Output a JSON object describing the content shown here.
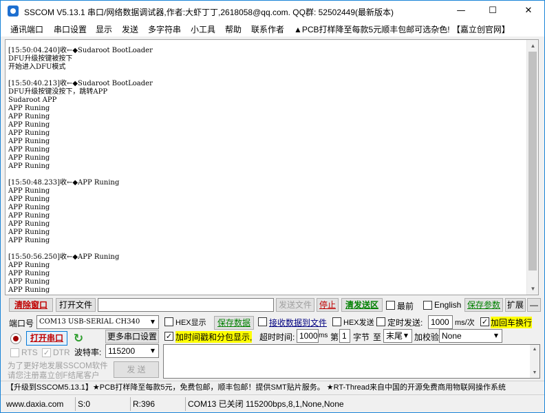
{
  "window": {
    "title": "SSCOM V5.13.1 串口/网络数据调试器,作者:大虾丁丁,2618058@qq.com. QQ群: 52502449(最新版本)",
    "minimize": "—",
    "maximize": "☐",
    "close": "✕"
  },
  "menu": {
    "items": [
      "通讯端口",
      "串口设置",
      "显示",
      "发送",
      "多字符串",
      "小工具",
      "帮助",
      "联系作者",
      "▲PCB打样降至每款5元顺丰包邮可选杂色! 【嘉立创官网】"
    ]
  },
  "receive": {
    "lines": [
      "[15:50:04.240]收←◆Sudaroot BootLoader",
      "DFU升级按键被按下",
      "开始进入DFU模式",
      "",
      "[15:50:40.213]收←◆Sudaroot BootLoader",
      "DFU升级按键没按下，跳转APP",
      "Sudaroot APP",
      "APP Runing",
      "APP Runing",
      "APP Runing",
      "APP Runing",
      "APP Runing",
      "APP Runing",
      "APP Runing",
      "APP Runing",
      "",
      "[15:50:48.233]收←◆APP Runing",
      "APP Runing",
      "APP Runing",
      "APP Runing",
      "APP Runing",
      "APP Runing",
      "APP Runing",
      "APP Runing",
      "",
      "[15:50:56.250]收←◆APP Runing",
      "APP Runing",
      "APP Runing",
      "APP Runing",
      "APP Runing"
    ]
  },
  "toolbar": {
    "clear_window": "清除窗口",
    "open_file": "打开文件",
    "file_path": "",
    "send_file": "发送文件",
    "stop": "停止",
    "clear_send": "清发送区",
    "last": "最前",
    "english": "English",
    "save_params": "保存参数",
    "expand": "扩展",
    "collapse": "—"
  },
  "port": {
    "port_label": "端口号",
    "port_value": "COM13 USB-SERIAL CH340",
    "open_port": "打开串口",
    "refresh_icon": "refresh-icon",
    "more_settings": "更多串口设置",
    "rts": "RTS",
    "dtr": "DTR",
    "baud_label": "波特率:",
    "baud_value": "115200",
    "promo_line1": "为了更好地发展SSCOM软件",
    "promo_line2": "请您注册嘉立创F结尾客户",
    "send": "发 送"
  },
  "options": {
    "hex_display": "HEX显示",
    "save_data": "保存数据",
    "recv_to_file": "接收数据到文件",
    "hex_send": "HEX发送",
    "timed_send": "定时发送:",
    "timed_value": "1000",
    "timed_unit": "ms/次",
    "add_newline": "加回车换行",
    "add_timestamp": "加时间戳和分包显示,",
    "timeout_label": "超时时间:",
    "timeout_value": "1000",
    "timeout_unit": "ms",
    "byte_no_label": "第",
    "byte_no_value": "1",
    "byte_unit": "字节",
    "to_label": "至",
    "to_value": "末尾",
    "checksum_label": "加校验",
    "checksum_value": "None"
  },
  "promo_bar": "【升级到SSCOM5.13.1】★PCB打样降至每款5元，免费包邮，顺丰包邮！提供SMT贴片服务。 ★RT-Thread来自中国的开源免费商用物联网操作系统",
  "status": {
    "site": "www.daxia.com",
    "sent": "S:0",
    "received": "R:396",
    "port_status": "COM13 已关闭  115200bps,8,1,None,None"
  },
  "colors": {
    "clear_red": "#c00000",
    "green_text": "#008000",
    "highlight": "#ffff00",
    "border_blue": "#1883d7"
  }
}
